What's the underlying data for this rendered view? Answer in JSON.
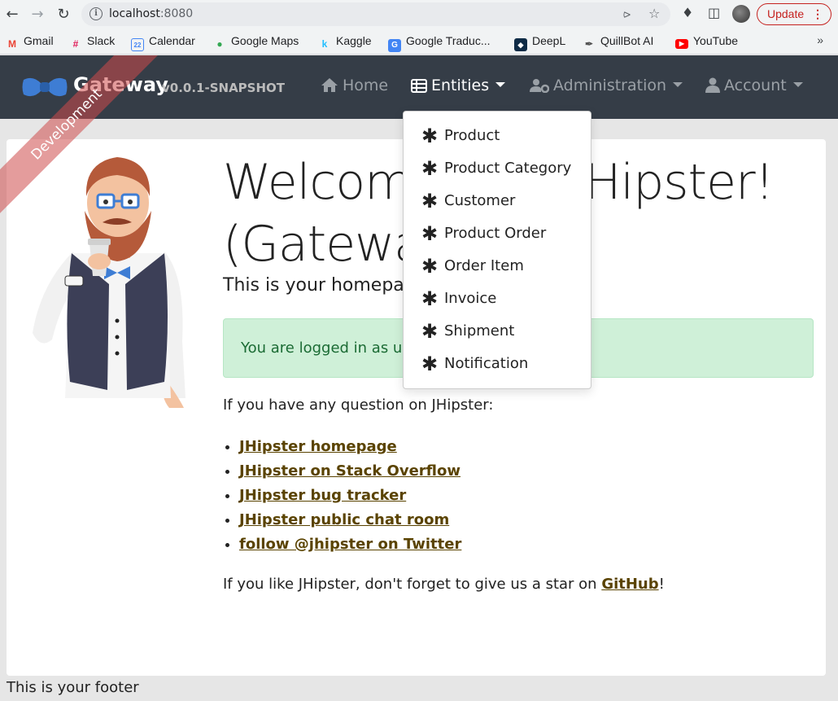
{
  "browser": {
    "url_host": "localhost",
    "url_port": ":8080",
    "update_label": "Update",
    "bookmarks": [
      {
        "label": "Gmail",
        "icon": "gmail-icon",
        "color": "#ea4335"
      },
      {
        "label": "Slack",
        "icon": "slack-icon",
        "color": "#611f69"
      },
      {
        "label": "Calendar",
        "icon": "calendar-icon",
        "color": "#4285f4"
      },
      {
        "label": "Google Maps",
        "icon": "maps-icon",
        "color": "#34a853"
      },
      {
        "label": "Kaggle",
        "icon": "kaggle-icon",
        "color": "#20beff"
      },
      {
        "label": "Google Traduc...",
        "icon": "translate-icon",
        "color": "#4285f4"
      },
      {
        "label": "DeepL",
        "icon": "deepl-icon",
        "color": "#0f2b46"
      },
      {
        "label": "QuillBot AI",
        "icon": "quillbot-icon",
        "color": "#499557"
      },
      {
        "label": "YouTube",
        "icon": "youtube-icon",
        "color": "#ff0000"
      }
    ]
  },
  "navbar": {
    "brand": "Gateway",
    "version": "v0.0.1-SNAPSHOT",
    "ribbon": "Development",
    "items": {
      "home": "Home",
      "entities": "Entities",
      "administration": "Administration",
      "account": "Account"
    }
  },
  "entities_menu": [
    "Product",
    "Product Category",
    "Customer",
    "Product Order",
    "Order Item",
    "Invoice",
    "Shipment",
    "Notification"
  ],
  "main": {
    "welcome_line1": "Welcome, Java Hipster!",
    "welcome_line2": "(Gateway)",
    "lead": "This is your homepage",
    "alert": "You are logged in as user",
    "question": "If you have any question on JHipster:",
    "links": [
      "JHipster homepage",
      "JHipster on Stack Overflow",
      "JHipster bug tracker",
      "JHipster public chat room",
      "follow @jhipster on Twitter"
    ],
    "star_prefix": "If you like JHipster, don't forget to give us a star on ",
    "star_link": "GitHub",
    "star_suffix": "!"
  },
  "footer": "This is your footer"
}
